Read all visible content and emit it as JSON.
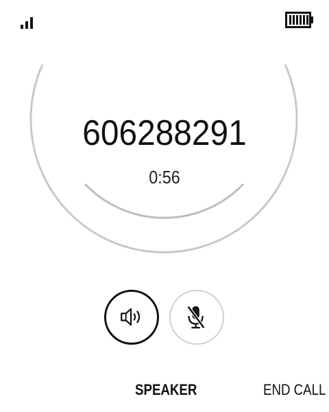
{
  "status_bar": {
    "signal_icon": "signal-bars-icon",
    "battery_icon": "battery-full-icon"
  },
  "call": {
    "number": "606288291",
    "duration": "0:56"
  },
  "controls": {
    "speaker_icon": "speaker-icon",
    "mute_icon": "microphone-muted-icon",
    "speaker_active": true
  },
  "softkeys": {
    "center": "SPEAKER",
    "right": "END CALL"
  }
}
